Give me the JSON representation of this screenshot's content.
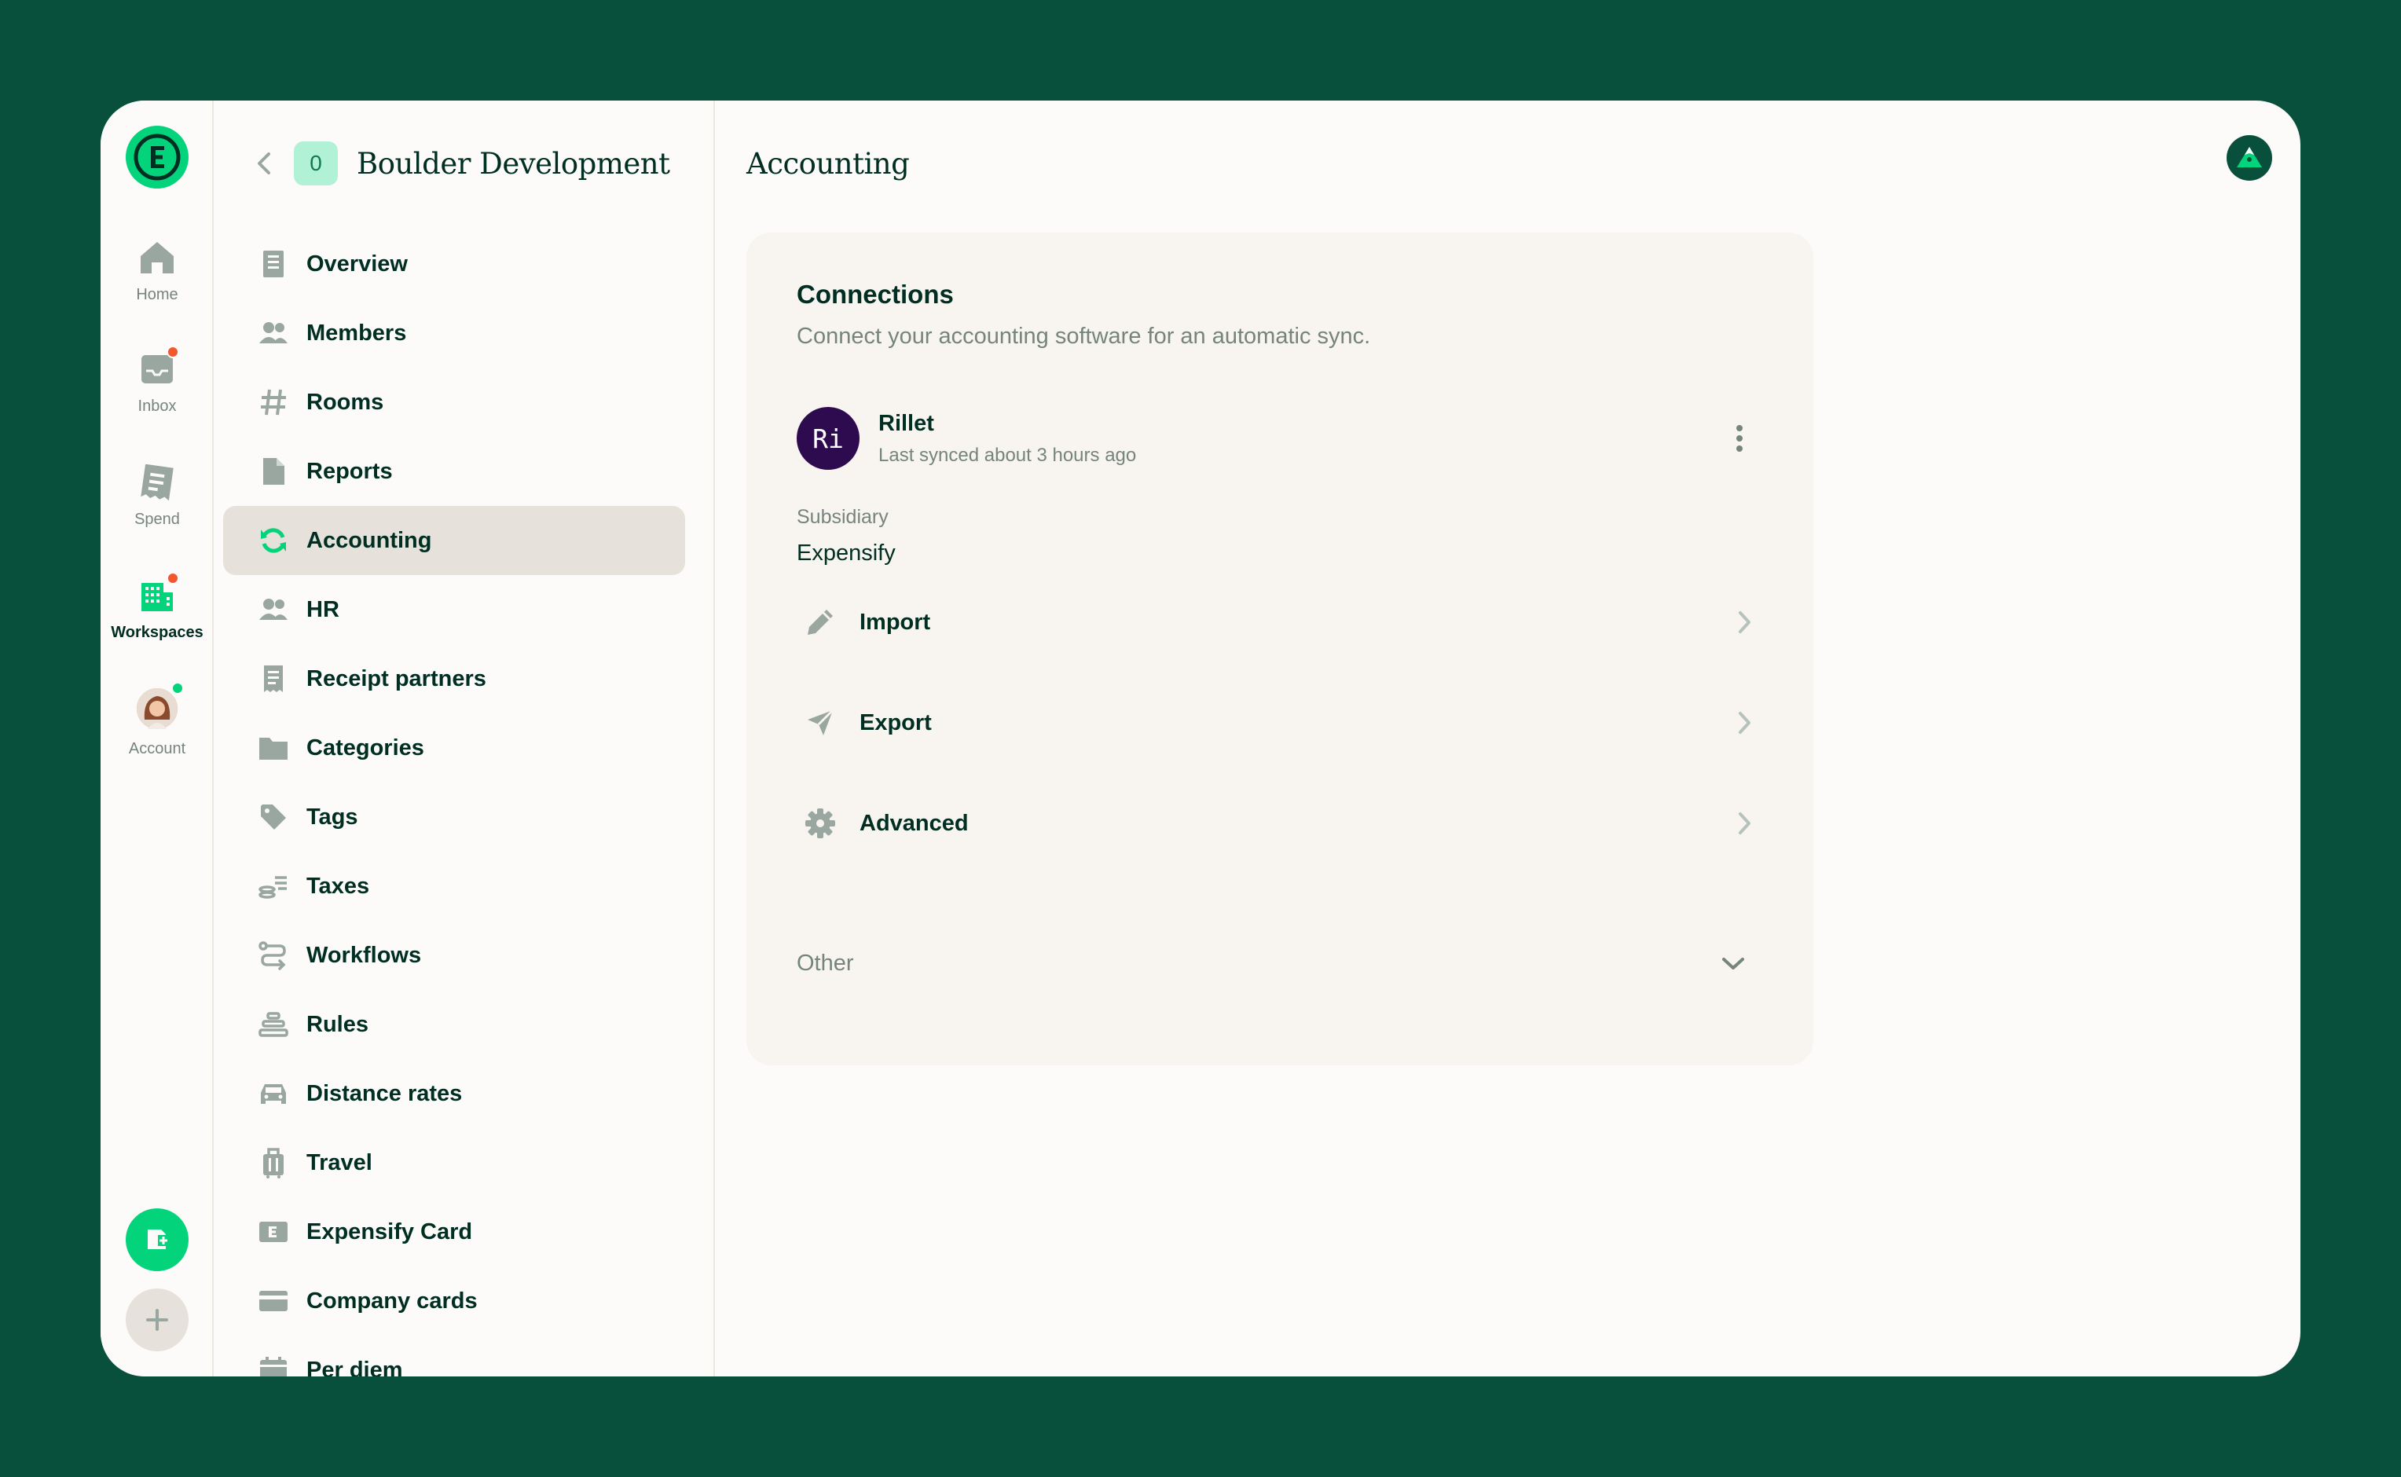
{
  "rail": {
    "home_label": "Home",
    "inbox_label": "Inbox",
    "spend_label": "Spend",
    "workspaces_label": "Workspaces",
    "account_label": "Account"
  },
  "workspace": {
    "badge": "0",
    "name": "Boulder Development"
  },
  "nav": {
    "items": [
      {
        "label": "Overview",
        "icon": "building-icon"
      },
      {
        "label": "Members",
        "icon": "users-icon"
      },
      {
        "label": "Rooms",
        "icon": "hashtag-icon"
      },
      {
        "label": "Reports",
        "icon": "document-icon"
      },
      {
        "label": "Accounting",
        "icon": "sync-icon"
      },
      {
        "label": "HR",
        "icon": "users-icon"
      },
      {
        "label": "Receipt partners",
        "icon": "receipt-icon"
      },
      {
        "label": "Categories",
        "icon": "folder-icon"
      },
      {
        "label": "Tags",
        "icon": "tag-icon"
      },
      {
        "label": "Taxes",
        "icon": "coins-icon"
      },
      {
        "label": "Workflows",
        "icon": "workflow-icon"
      },
      {
        "label": "Rules",
        "icon": "stack-icon"
      },
      {
        "label": "Distance rates",
        "icon": "car-icon"
      },
      {
        "label": "Travel",
        "icon": "suitcase-icon"
      },
      {
        "label": "Expensify Card",
        "icon": "card-e-icon"
      },
      {
        "label": "Company cards",
        "icon": "credit-card-icon"
      },
      {
        "label": "Per diem",
        "icon": "calendar-icon"
      }
    ],
    "active_index": 4
  },
  "main": {
    "title": "Accounting",
    "card": {
      "title": "Connections",
      "subtitle": "Connect your accounting software for an automatic sync.",
      "connection": {
        "avatar_text": "Ri",
        "name": "Rillet",
        "sync_status": "Last synced about 3 hours ago"
      },
      "subsidiary_label": "Subsidiary",
      "subsidiary_value": "Expensify",
      "menu": {
        "import": "Import",
        "export": "Export",
        "advanced": "Advanced"
      },
      "other_label": "Other"
    }
  },
  "colors": {
    "brand_green": "#03d47c",
    "background": "#08503c",
    "notification_red": "#f25730",
    "connection_purple": "#2e0a4e"
  }
}
